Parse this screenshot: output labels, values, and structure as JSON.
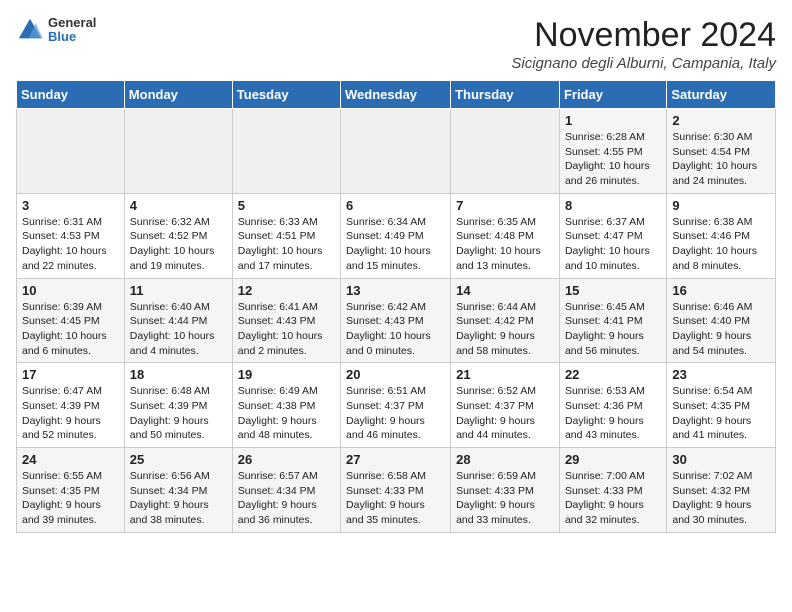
{
  "logo": {
    "general": "General",
    "blue": "Blue"
  },
  "title": "November 2024",
  "location": "Sicignano degli Alburni, Campania, Italy",
  "days_of_week": [
    "Sunday",
    "Monday",
    "Tuesday",
    "Wednesday",
    "Thursday",
    "Friday",
    "Saturday"
  ],
  "weeks": [
    [
      {
        "day": "",
        "sunrise": "",
        "sunset": "",
        "daylight": ""
      },
      {
        "day": "",
        "sunrise": "",
        "sunset": "",
        "daylight": ""
      },
      {
        "day": "",
        "sunrise": "",
        "sunset": "",
        "daylight": ""
      },
      {
        "day": "",
        "sunrise": "",
        "sunset": "",
        "daylight": ""
      },
      {
        "day": "",
        "sunrise": "",
        "sunset": "",
        "daylight": ""
      },
      {
        "day": "1",
        "sunrise": "Sunrise: 6:28 AM",
        "sunset": "Sunset: 4:55 PM",
        "daylight": "Daylight: 10 hours and 26 minutes."
      },
      {
        "day": "2",
        "sunrise": "Sunrise: 6:30 AM",
        "sunset": "Sunset: 4:54 PM",
        "daylight": "Daylight: 10 hours and 24 minutes."
      }
    ],
    [
      {
        "day": "3",
        "sunrise": "Sunrise: 6:31 AM",
        "sunset": "Sunset: 4:53 PM",
        "daylight": "Daylight: 10 hours and 22 minutes."
      },
      {
        "day": "4",
        "sunrise": "Sunrise: 6:32 AM",
        "sunset": "Sunset: 4:52 PM",
        "daylight": "Daylight: 10 hours and 19 minutes."
      },
      {
        "day": "5",
        "sunrise": "Sunrise: 6:33 AM",
        "sunset": "Sunset: 4:51 PM",
        "daylight": "Daylight: 10 hours and 17 minutes."
      },
      {
        "day": "6",
        "sunrise": "Sunrise: 6:34 AM",
        "sunset": "Sunset: 4:49 PM",
        "daylight": "Daylight: 10 hours and 15 minutes."
      },
      {
        "day": "7",
        "sunrise": "Sunrise: 6:35 AM",
        "sunset": "Sunset: 4:48 PM",
        "daylight": "Daylight: 10 hours and 13 minutes."
      },
      {
        "day": "8",
        "sunrise": "Sunrise: 6:37 AM",
        "sunset": "Sunset: 4:47 PM",
        "daylight": "Daylight: 10 hours and 10 minutes."
      },
      {
        "day": "9",
        "sunrise": "Sunrise: 6:38 AM",
        "sunset": "Sunset: 4:46 PM",
        "daylight": "Daylight: 10 hours and 8 minutes."
      }
    ],
    [
      {
        "day": "10",
        "sunrise": "Sunrise: 6:39 AM",
        "sunset": "Sunset: 4:45 PM",
        "daylight": "Daylight: 10 hours and 6 minutes."
      },
      {
        "day": "11",
        "sunrise": "Sunrise: 6:40 AM",
        "sunset": "Sunset: 4:44 PM",
        "daylight": "Daylight: 10 hours and 4 minutes."
      },
      {
        "day": "12",
        "sunrise": "Sunrise: 6:41 AM",
        "sunset": "Sunset: 4:43 PM",
        "daylight": "Daylight: 10 hours and 2 minutes."
      },
      {
        "day": "13",
        "sunrise": "Sunrise: 6:42 AM",
        "sunset": "Sunset: 4:43 PM",
        "daylight": "Daylight: 10 hours and 0 minutes."
      },
      {
        "day": "14",
        "sunrise": "Sunrise: 6:44 AM",
        "sunset": "Sunset: 4:42 PM",
        "daylight": "Daylight: 9 hours and 58 minutes."
      },
      {
        "day": "15",
        "sunrise": "Sunrise: 6:45 AM",
        "sunset": "Sunset: 4:41 PM",
        "daylight": "Daylight: 9 hours and 56 minutes."
      },
      {
        "day": "16",
        "sunrise": "Sunrise: 6:46 AM",
        "sunset": "Sunset: 4:40 PM",
        "daylight": "Daylight: 9 hours and 54 minutes."
      }
    ],
    [
      {
        "day": "17",
        "sunrise": "Sunrise: 6:47 AM",
        "sunset": "Sunset: 4:39 PM",
        "daylight": "Daylight: 9 hours and 52 minutes."
      },
      {
        "day": "18",
        "sunrise": "Sunrise: 6:48 AM",
        "sunset": "Sunset: 4:39 PM",
        "daylight": "Daylight: 9 hours and 50 minutes."
      },
      {
        "day": "19",
        "sunrise": "Sunrise: 6:49 AM",
        "sunset": "Sunset: 4:38 PM",
        "daylight": "Daylight: 9 hours and 48 minutes."
      },
      {
        "day": "20",
        "sunrise": "Sunrise: 6:51 AM",
        "sunset": "Sunset: 4:37 PM",
        "daylight": "Daylight: 9 hours and 46 minutes."
      },
      {
        "day": "21",
        "sunrise": "Sunrise: 6:52 AM",
        "sunset": "Sunset: 4:37 PM",
        "daylight": "Daylight: 9 hours and 44 minutes."
      },
      {
        "day": "22",
        "sunrise": "Sunrise: 6:53 AM",
        "sunset": "Sunset: 4:36 PM",
        "daylight": "Daylight: 9 hours and 43 minutes."
      },
      {
        "day": "23",
        "sunrise": "Sunrise: 6:54 AM",
        "sunset": "Sunset: 4:35 PM",
        "daylight": "Daylight: 9 hours and 41 minutes."
      }
    ],
    [
      {
        "day": "24",
        "sunrise": "Sunrise: 6:55 AM",
        "sunset": "Sunset: 4:35 PM",
        "daylight": "Daylight: 9 hours and 39 minutes."
      },
      {
        "day": "25",
        "sunrise": "Sunrise: 6:56 AM",
        "sunset": "Sunset: 4:34 PM",
        "daylight": "Daylight: 9 hours and 38 minutes."
      },
      {
        "day": "26",
        "sunrise": "Sunrise: 6:57 AM",
        "sunset": "Sunset: 4:34 PM",
        "daylight": "Daylight: 9 hours and 36 minutes."
      },
      {
        "day": "27",
        "sunrise": "Sunrise: 6:58 AM",
        "sunset": "Sunset: 4:33 PM",
        "daylight": "Daylight: 9 hours and 35 minutes."
      },
      {
        "day": "28",
        "sunrise": "Sunrise: 6:59 AM",
        "sunset": "Sunset: 4:33 PM",
        "daylight": "Daylight: 9 hours and 33 minutes."
      },
      {
        "day": "29",
        "sunrise": "Sunrise: 7:00 AM",
        "sunset": "Sunset: 4:33 PM",
        "daylight": "Daylight: 9 hours and 32 minutes."
      },
      {
        "day": "30",
        "sunrise": "Sunrise: 7:02 AM",
        "sunset": "Sunset: 4:32 PM",
        "daylight": "Daylight: 9 hours and 30 minutes."
      }
    ]
  ]
}
